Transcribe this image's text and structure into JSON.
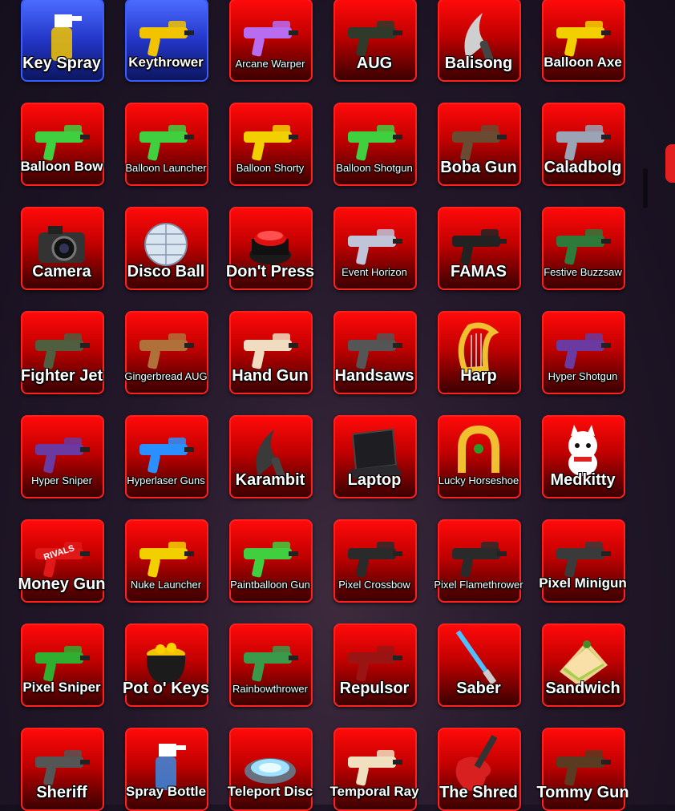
{
  "items": [
    {
      "label": "Key Spray",
      "size": "lg",
      "frame": "blue",
      "icon": "key-spray-icon",
      "color": "#f2c400"
    },
    {
      "label": "Keythrower",
      "size": "md",
      "frame": "blue",
      "icon": "keythrower-icon",
      "color": "#f2c400"
    },
    {
      "label": "Arcane Warper",
      "size": "sm",
      "frame": "red",
      "icon": "arcane-warper-icon",
      "color": "#b86cf0"
    },
    {
      "label": "AUG",
      "size": "lg",
      "frame": "red",
      "icon": "aug-icon",
      "color": "#2f3a2a"
    },
    {
      "label": "Balisong",
      "size": "lg",
      "frame": "red",
      "icon": "balisong-icon",
      "color": "#cfcfcf"
    },
    {
      "label": "Balloon Axe",
      "size": "md",
      "frame": "red",
      "icon": "balloon-axe-icon",
      "color": "#f2d000"
    },
    {
      "label": "Balloon Bow",
      "size": "md",
      "frame": "red",
      "icon": "balloon-bow-icon",
      "color": "#3fcf3f"
    },
    {
      "label": "Balloon Launcher",
      "size": "sm",
      "frame": "red",
      "icon": "balloon-launcher-icon",
      "color": "#3fcf3f"
    },
    {
      "label": "Balloon Shorty",
      "size": "sm",
      "frame": "red",
      "icon": "balloon-shorty-icon",
      "color": "#f2d000"
    },
    {
      "label": "Balloon Shotgun",
      "size": "sm",
      "frame": "red",
      "icon": "balloon-shotgun-icon",
      "color": "#3fcf3f"
    },
    {
      "label": "Boba Gun",
      "size": "lg",
      "frame": "red",
      "icon": "boba-gun-icon",
      "color": "#6a4a30"
    },
    {
      "label": "Caladbolg",
      "size": "lg",
      "frame": "red",
      "icon": "caladbolg-icon",
      "color": "#9aa4b4"
    },
    {
      "label": "Camera",
      "size": "lg",
      "frame": "red",
      "icon": "camera-icon",
      "color": "#333333"
    },
    {
      "label": "Disco Ball",
      "size": "lg",
      "frame": "red",
      "icon": "disco-ball-icon",
      "color": "#d8e4f0"
    },
    {
      "label": "Don't Press",
      "size": "lg",
      "frame": "red",
      "icon": "button-icon",
      "color": "#e01010"
    },
    {
      "label": "Event Horizon",
      "size": "sm",
      "frame": "red",
      "icon": "event-horizon-icon",
      "color": "#c0c4d8"
    },
    {
      "label": "FAMAS",
      "size": "lg",
      "frame": "red",
      "icon": "famas-icon",
      "color": "#222222"
    },
    {
      "label": "Festive Buzzsaw",
      "size": "sm",
      "frame": "red",
      "icon": "festive-buzzsaw-icon",
      "color": "#2e7a3a"
    },
    {
      "label": "Fighter Jet",
      "size": "lg",
      "frame": "red",
      "icon": "fighter-jet-icon",
      "color": "#4e5e3e"
    },
    {
      "label": "Gingerbread AUG",
      "size": "sm",
      "frame": "red",
      "icon": "gingerbread-aug-icon",
      "color": "#b0703a"
    },
    {
      "label": "Hand Gun",
      "size": "lg",
      "frame": "red",
      "icon": "hand-gun-icon",
      "color": "#f0dcc0"
    },
    {
      "label": "Handsaws",
      "size": "lg",
      "frame": "red",
      "icon": "handsaws-icon",
      "color": "#555555"
    },
    {
      "label": "Harp",
      "size": "lg",
      "frame": "red",
      "icon": "harp-icon",
      "color": "#f0c030"
    },
    {
      "label": "Hyper Shotgun",
      "size": "sm",
      "frame": "red",
      "icon": "hyper-shotgun-icon",
      "color": "#6a3aa0"
    },
    {
      "label": "Hyper Sniper",
      "size": "sm",
      "frame": "red",
      "icon": "hyper-sniper-icon",
      "color": "#6a3aa0"
    },
    {
      "label": "Hyperlaser Guns",
      "size": "sm",
      "frame": "red",
      "icon": "hyperlaser-guns-icon",
      "color": "#2a90ff"
    },
    {
      "label": "Karambit",
      "size": "lg",
      "frame": "red",
      "icon": "karambit-icon",
      "color": "#3a3a3a"
    },
    {
      "label": "Laptop",
      "size": "lg",
      "frame": "red",
      "icon": "laptop-icon",
      "color": "#1e1e22"
    },
    {
      "label": "Lucky Horseshoe",
      "size": "sm",
      "frame": "red",
      "icon": "lucky-horseshoe-icon",
      "color": "#f0c030"
    },
    {
      "label": "Medkitty",
      "size": "lg",
      "frame": "red",
      "icon": "medkitty-icon",
      "color": "#ffffff"
    },
    {
      "label": "Money Gun",
      "size": "lg",
      "frame": "red",
      "icon": "money-gun-icon",
      "color": "#e01818",
      "badge": "RIVALS"
    },
    {
      "label": "Nuke Launcher",
      "size": "sm",
      "frame": "red",
      "icon": "nuke-launcher-icon",
      "color": "#f2d000"
    },
    {
      "label": "Paintballoon Gun",
      "size": "sm",
      "frame": "red",
      "icon": "paintballoon-gun-icon",
      "color": "#3fcf3f"
    },
    {
      "label": "Pixel Crossbow",
      "size": "sm",
      "frame": "red",
      "icon": "pixel-crossbow-icon",
      "color": "#2a2a2a"
    },
    {
      "label": "Pixel Flamethrower",
      "size": "sm",
      "frame": "red",
      "icon": "pixel-flamethrower-icon",
      "color": "#2a2a2a"
    },
    {
      "label": "Pixel Minigun",
      "size": "md",
      "frame": "red",
      "icon": "pixel-minigun-icon",
      "color": "#3a3a3a"
    },
    {
      "label": "Pixel Sniper",
      "size": "md",
      "frame": "red",
      "icon": "pixel-sniper-icon",
      "color": "#2fae2f"
    },
    {
      "label": "Pot o' Keys",
      "size": "lg",
      "frame": "red",
      "icon": "pot-o-keys-icon",
      "color": "#f2c400"
    },
    {
      "label": "Rainbowthrower",
      "size": "sm",
      "frame": "red",
      "icon": "rainbowthrower-icon",
      "color": "#3a9a4a"
    },
    {
      "label": "Repulsor",
      "size": "lg",
      "frame": "red",
      "icon": "repulsor-icon",
      "color": "#9a1414"
    },
    {
      "label": "Saber",
      "size": "lg",
      "frame": "red",
      "icon": "saber-icon",
      "color": "#4ec0ff"
    },
    {
      "label": "Sandwich",
      "size": "lg",
      "frame": "red",
      "icon": "sandwich-icon",
      "color": "#f0d090"
    },
    {
      "label": "Sheriff",
      "size": "lg",
      "frame": "red",
      "icon": "sheriff-icon",
      "color": "#555555"
    },
    {
      "label": "Spray Bottle",
      "size": "md",
      "frame": "red",
      "icon": "spray-bottle-icon",
      "color": "#3a8ae0"
    },
    {
      "label": "Teleport Disc",
      "size": "md",
      "frame": "red",
      "icon": "teleport-disc-icon",
      "color": "#a0e0ff"
    },
    {
      "label": "Temporal Ray",
      "size": "md",
      "frame": "red",
      "icon": "temporal-ray-icon",
      "color": "#f0e0c0"
    },
    {
      "label": "The Shred",
      "size": "lg",
      "frame": "red",
      "icon": "guitar-icon",
      "color": "#d82020"
    },
    {
      "label": "Tommy Gun",
      "size": "lg",
      "frame": "red",
      "icon": "tommy-gun-icon",
      "color": "#5a3a20"
    }
  ]
}
